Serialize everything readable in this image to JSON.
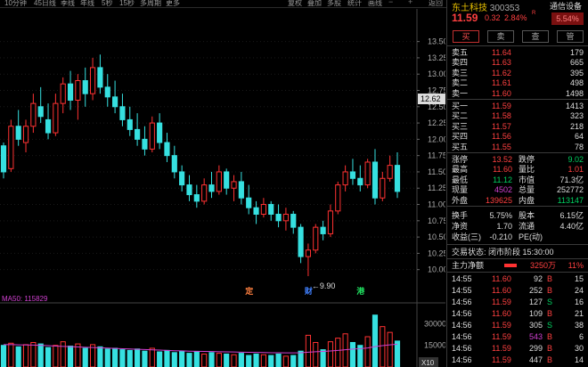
{
  "topbar": {
    "periods": [
      "10分钟",
      "45日线",
      "季线",
      "年线",
      "5秒",
      "15秒",
      "多周期",
      "更多"
    ],
    "tools": [
      "复权",
      "叠加",
      "多股",
      "统计",
      "画线",
      "",
      "",
      "返回"
    ]
  },
  "chart_data": {
    "type": "candlestick",
    "y_ticks": [
      "13.50",
      "13.25",
      "13.00",
      "12.75",
      "12.50",
      "12.25",
      "12.00",
      "11.75",
      "11.50",
      "11.25",
      "11.00",
      "10.75",
      "10.50",
      "10.25",
      "10.00"
    ],
    "ylim": [
      9.9,
      13.7
    ],
    "current_price_label": "12.62",
    "low_annotation": "←9.90",
    "event_markers": [
      "定",
      "财",
      "港"
    ],
    "candles": [
      [
        11.9,
        11.95,
        11.4,
        11.5
      ],
      [
        11.55,
        12.3,
        11.5,
        12.2
      ],
      [
        12.2,
        12.45,
        11.9,
        12.0
      ],
      [
        11.95,
        12.3,
        11.8,
        12.2
      ],
      [
        12.2,
        12.7,
        12.1,
        12.55
      ],
      [
        12.5,
        12.8,
        12.25,
        12.35
      ],
      [
        12.3,
        12.55,
        12.0,
        12.1
      ],
      [
        12.1,
        12.7,
        12.05,
        12.55
      ],
      [
        12.55,
        12.95,
        12.4,
        12.85
      ],
      [
        12.85,
        13.05,
        12.45,
        12.6
      ],
      [
        12.6,
        13.0,
        12.3,
        12.9
      ],
      [
        12.9,
        13.1,
        12.5,
        12.7
      ],
      [
        12.7,
        13.25,
        12.6,
        13.1
      ],
      [
        13.1,
        13.3,
        12.7,
        12.8
      ],
      [
        12.8,
        13.0,
        12.5,
        12.65
      ],
      [
        12.65,
        12.9,
        12.4,
        12.5
      ],
      [
        12.5,
        12.7,
        12.2,
        12.3
      ],
      [
        12.3,
        12.5,
        12.05,
        12.15
      ],
      [
        12.15,
        12.4,
        11.9,
        12.0
      ],
      [
        12.0,
        12.2,
        11.75,
        11.85
      ],
      [
        11.85,
        12.35,
        11.8,
        12.25
      ],
      [
        12.25,
        12.4,
        11.85,
        11.95
      ],
      [
        11.95,
        12.1,
        11.65,
        11.75
      ],
      [
        11.75,
        11.9,
        11.4,
        11.5
      ],
      [
        11.5,
        11.6,
        11.2,
        11.3
      ],
      [
        11.3,
        11.45,
        11.05,
        11.15
      ],
      [
        11.15,
        11.3,
        10.95,
        11.05
      ],
      [
        11.05,
        11.4,
        11.0,
        11.3
      ],
      [
        11.3,
        11.5,
        11.1,
        11.2
      ],
      [
        11.2,
        11.6,
        11.15,
        11.5
      ],
      [
        11.5,
        11.55,
        11.15,
        11.25
      ],
      [
        11.25,
        11.45,
        11.05,
        11.35
      ],
      [
        11.35,
        11.5,
        11.0,
        11.1
      ],
      [
        11.1,
        11.3,
        10.85,
        10.95
      ],
      [
        10.95,
        11.05,
        10.7,
        10.85
      ],
      [
        10.85,
        11.1,
        10.8,
        11.0
      ],
      [
        11.0,
        11.05,
        10.75,
        10.85
      ],
      [
        10.85,
        11.0,
        10.65,
        10.75
      ],
      [
        10.75,
        10.95,
        10.6,
        10.85
      ],
      [
        10.85,
        10.9,
        10.55,
        10.65
      ],
      [
        10.65,
        10.7,
        10.1,
        10.2
      ],
      [
        10.2,
        10.4,
        9.9,
        10.3
      ],
      [
        10.3,
        10.7,
        10.25,
        10.65
      ],
      [
        10.65,
        10.75,
        10.45,
        10.55
      ],
      [
        10.55,
        11.0,
        10.5,
        10.9
      ],
      [
        10.9,
        11.35,
        10.85,
        11.3
      ],
      [
        11.3,
        11.6,
        11.2,
        11.5
      ],
      [
        11.5,
        11.7,
        11.3,
        11.4
      ],
      [
        11.4,
        11.6,
        11.2,
        11.3
      ],
      [
        11.3,
        11.7,
        11.25,
        11.65
      ],
      [
        11.65,
        11.85,
        11.0,
        11.1
      ],
      [
        11.1,
        11.5,
        11.05,
        11.4
      ],
      [
        11.4,
        11.75,
        11.35,
        11.6
      ],
      [
        11.6,
        11.8,
        11.1,
        11.2
      ]
    ],
    "volume": {
      "indicator": "MA50: 115829",
      "y_ticks": [
        "30000",
        "15000"
      ],
      "unit_label": "X10",
      "values": [
        15000,
        16500,
        14000,
        15500,
        17000,
        16000,
        13500,
        15000,
        17500,
        14500,
        16000,
        13000,
        15500,
        14000,
        12500,
        13000,
        12000,
        11500,
        12500,
        11000,
        13000,
        10500,
        11500,
        10000,
        11000,
        9500,
        10500,
        9000,
        10000,
        9500,
        9000,
        8500,
        9500,
        8000,
        9000,
        8500,
        8000,
        9000,
        7500,
        8000,
        11000,
        22000,
        17000,
        12000,
        17500,
        20000,
        23000,
        17000,
        15000,
        21000,
        36000,
        28000,
        24000,
        18000
      ],
      "ma": [
        15500,
        15600,
        15400,
        15300,
        15200,
        15000,
        14800,
        14500,
        14300,
        14100,
        13900,
        13700,
        13500,
        13300,
        13100,
        12900,
        12700,
        12500,
        12300,
        12100,
        11900,
        11700,
        11500,
        11300,
        11200,
        11000,
        10900,
        10800,
        10700,
        10600,
        10500,
        10400,
        10300,
        10200,
        10100,
        10000,
        9900,
        9900,
        9800,
        9800,
        9900,
        10300,
        10600,
        10800,
        11100,
        11500,
        12000,
        12400,
        12700,
        13200,
        14100,
        14800,
        15400,
        15800
      ]
    }
  },
  "quote": {
    "name": "东土科技",
    "code": "300353",
    "sector": "通信设备",
    "price": "11.59",
    "change": "0.32",
    "change_pct": "2.84%",
    "flag": "R",
    "sector_pct": "5.54%",
    "actions": [
      "买",
      "卖",
      "查",
      "管"
    ],
    "asks": [
      {
        "label": "卖五",
        "price": "11.64",
        "vol": "179"
      },
      {
        "label": "卖四",
        "price": "11.63",
        "vol": "665"
      },
      {
        "label": "卖三",
        "price": "11.62",
        "vol": "395"
      },
      {
        "label": "卖二",
        "price": "11.61",
        "vol": "498"
      },
      {
        "label": "卖一",
        "price": "11.60",
        "vol": "1498"
      }
    ],
    "bids": [
      {
        "label": "买一",
        "price": "11.59",
        "vol": "1413"
      },
      {
        "label": "买二",
        "price": "11.58",
        "vol": "323"
      },
      {
        "label": "买三",
        "price": "11.57",
        "vol": "218"
      },
      {
        "label": "买四",
        "price": "11.56",
        "vol": "64"
      },
      {
        "label": "买五",
        "price": "11.55",
        "vol": "78"
      }
    ],
    "stats": [
      {
        "l1": "涨停",
        "v1": "13.52",
        "c1": "red",
        "l2": "跌停",
        "v2": "9.02",
        "c2": "grn"
      },
      {
        "l1": "最高",
        "v1": "11.60",
        "c1": "red",
        "l2": "量比",
        "v2": "1.01",
        "c2": "red"
      },
      {
        "l1": "最低",
        "v1": "11.12",
        "c1": "grn",
        "l2": "市值",
        "v2": "71.3亿",
        "c2": "wht"
      },
      {
        "l1": "现量",
        "v1": "4502",
        "c1": "mag",
        "l2": "总量",
        "v2": "252772",
        "c2": "wht"
      },
      {
        "l1": "外盘",
        "v1": "139625",
        "c1": "red",
        "l2": "内盘",
        "v2": "113147",
        "c2": "grn"
      }
    ],
    "stats2": [
      {
        "l1": "换手",
        "v1": "5.75%",
        "c1": "wht",
        "l2": "股本",
        "v2": "6.15亿",
        "c2": "wht"
      },
      {
        "l1": "净资",
        "v1": "1.70",
        "c1": "wht",
        "l2": "流通",
        "v2": "4.40亿",
        "c2": "wht"
      },
      {
        "l1": "收益(三)",
        "v1": "-0.210",
        "c1": "wht",
        "l2": "PE(动)",
        "v2": "",
        "c2": "wht"
      }
    ],
    "trade_status": "交易状态: 闭市阶段 15:30:00",
    "main_flow_label": "主力净额",
    "main_flow_value": "3250万",
    "main_flow_pct": "11%",
    "ticks": [
      {
        "t": "14:55",
        "p": "11.60",
        "v": "92",
        "d": "B",
        "n": "15",
        "vc": "wht"
      },
      {
        "t": "14:55",
        "p": "11.60",
        "v": "252",
        "d": "B",
        "n": "24",
        "vc": "wht"
      },
      {
        "t": "14:56",
        "p": "11.59",
        "v": "127",
        "d": "S",
        "n": "16",
        "vc": "wht"
      },
      {
        "t": "14:56",
        "p": "11.60",
        "v": "109",
        "d": "B",
        "n": "21",
        "vc": "wht"
      },
      {
        "t": "14:56",
        "p": "11.59",
        "v": "305",
        "d": "S",
        "n": "38",
        "vc": "wht"
      },
      {
        "t": "14:56",
        "p": "11.59",
        "v": "543",
        "d": "B",
        "n": "6",
        "vc": "mag"
      },
      {
        "t": "14:56",
        "p": "11.59",
        "v": "299",
        "d": "B",
        "n": "30",
        "vc": "wht"
      },
      {
        "t": "14:56",
        "p": "11.59",
        "v": "447",
        "d": "B",
        "n": "14",
        "vc": "wht"
      }
    ]
  }
}
